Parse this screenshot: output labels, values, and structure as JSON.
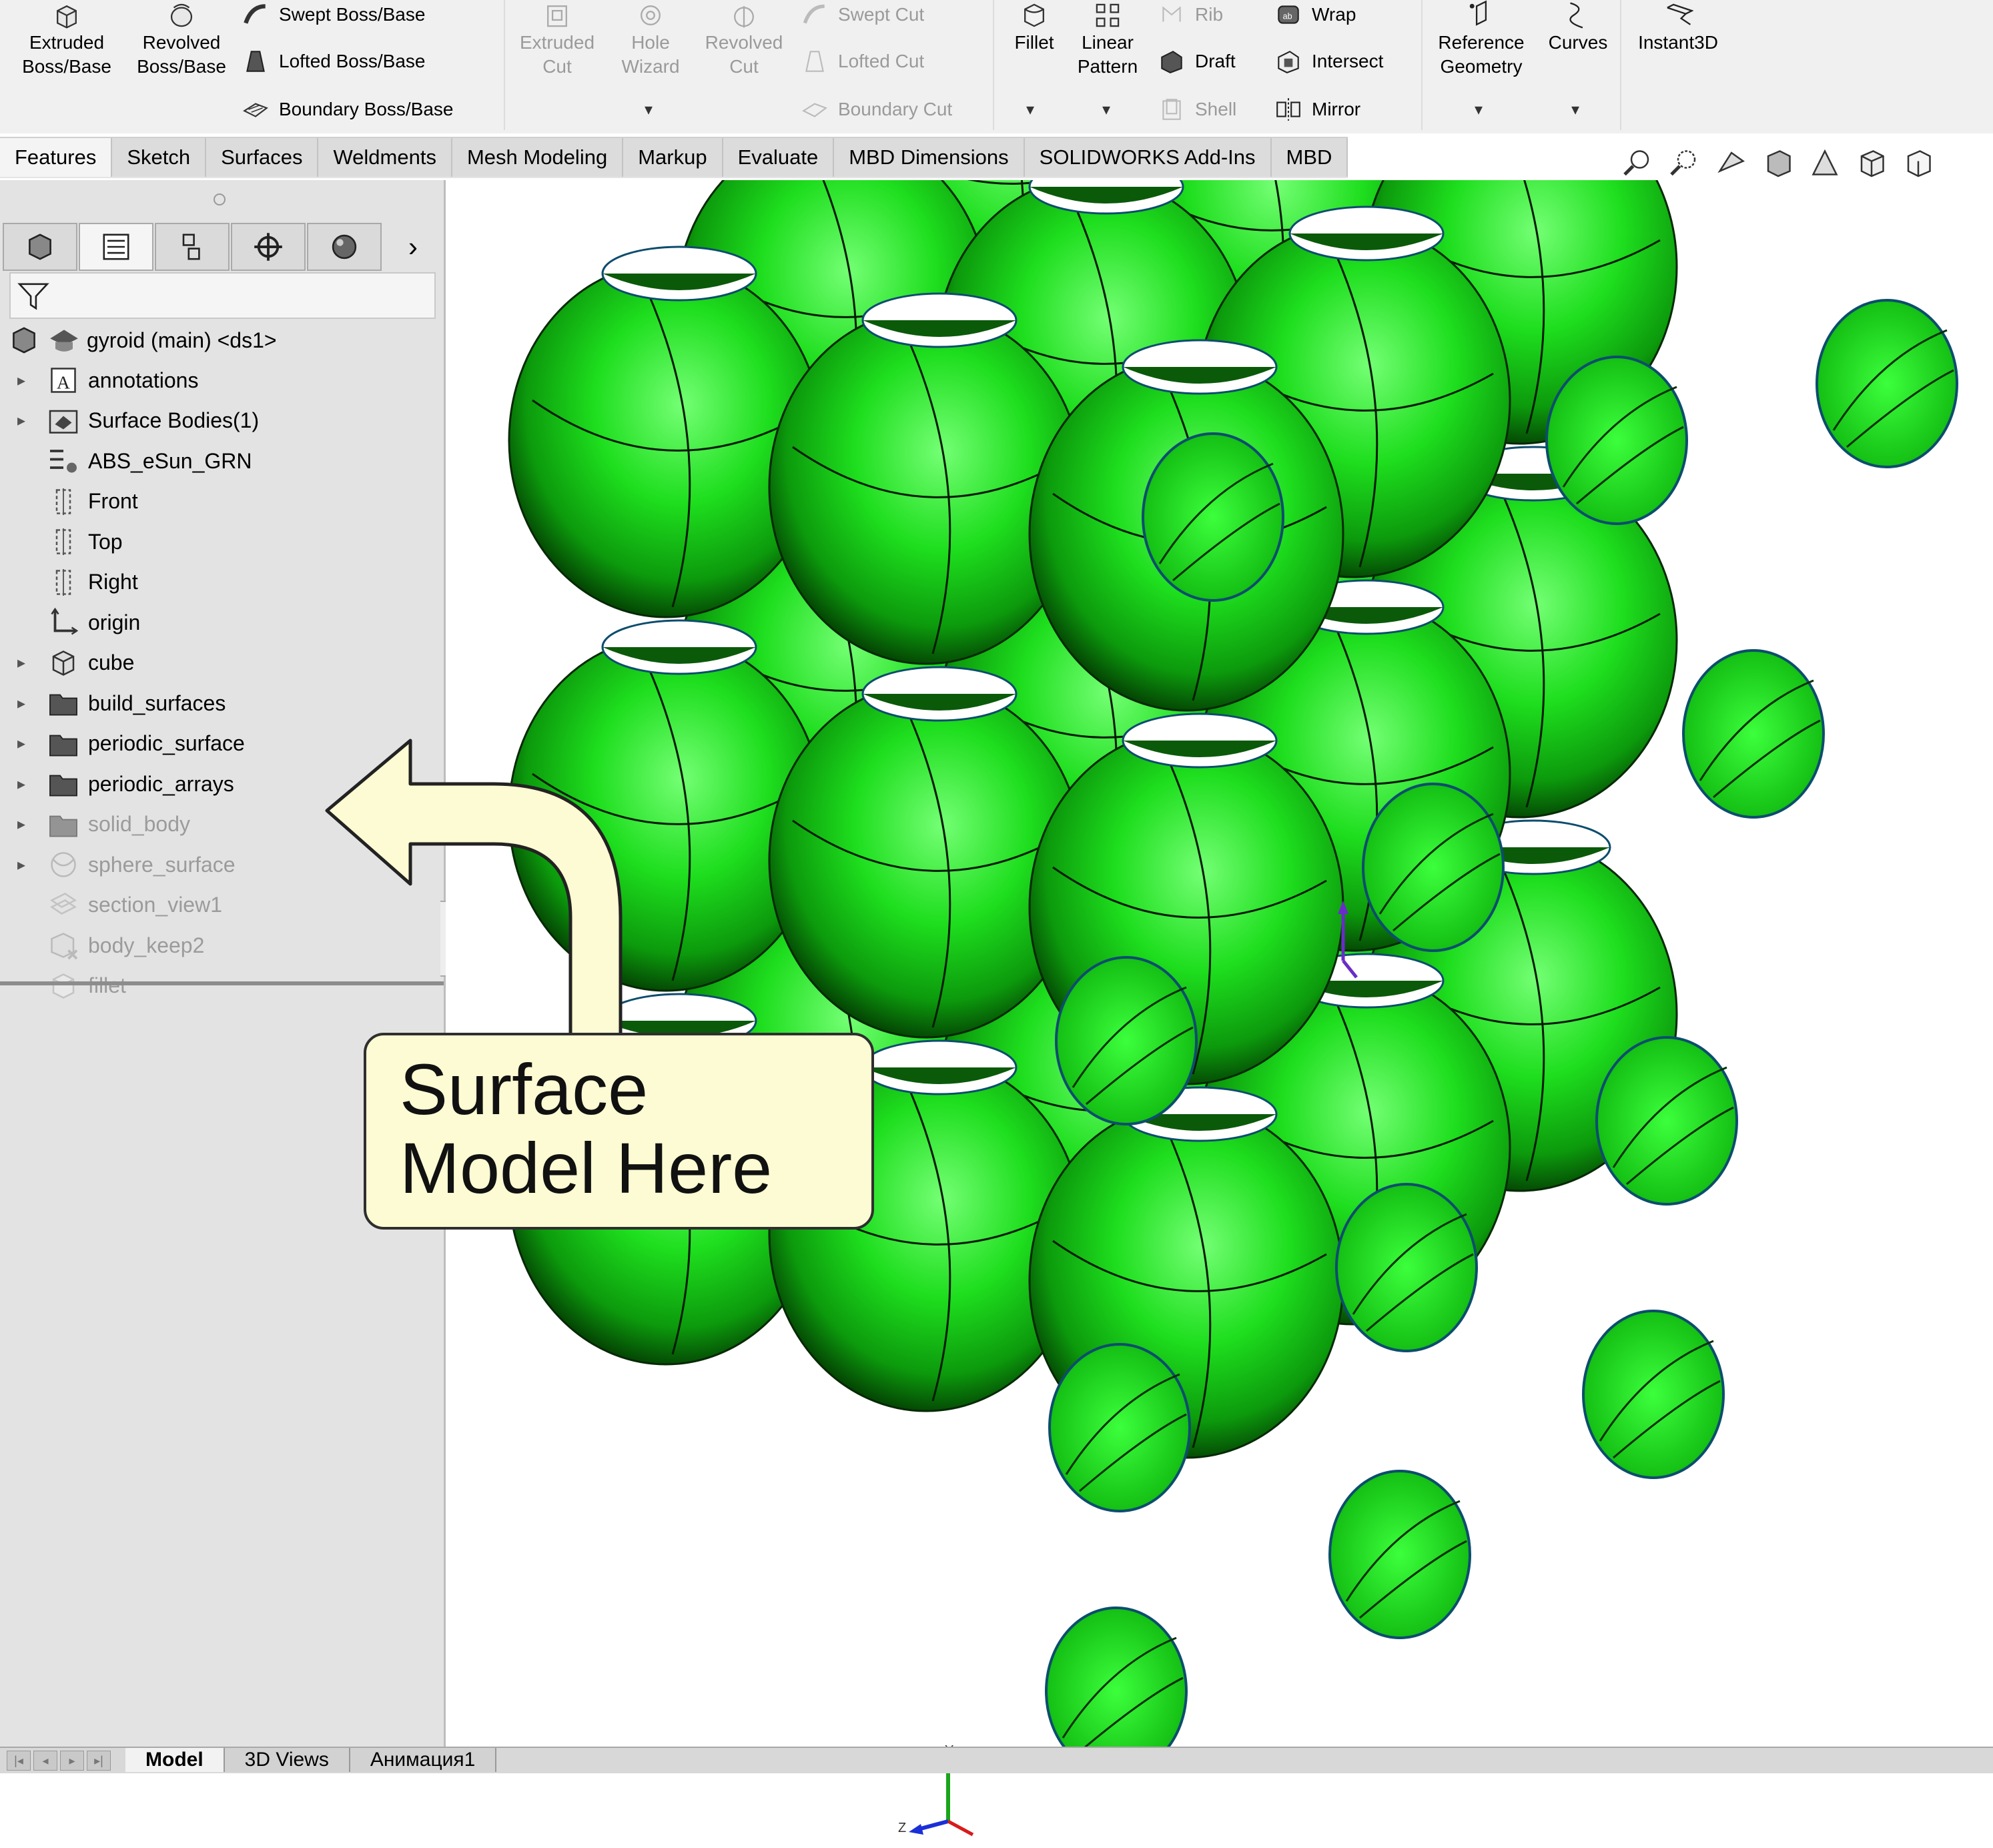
{
  "ribbon": {
    "extruded_boss": "Extruded\nBoss/Base",
    "revolved_boss": "Revolved\nBoss/Base",
    "swept_boss": "Swept Boss/Base",
    "lofted_boss": "Lofted Boss/Base",
    "boundary_boss": "Boundary Boss/Base",
    "extruded_cut": "Extruded\nCut",
    "hole_wizard": "Hole\nWizard",
    "revolved_cut": "Revolved\nCut",
    "swept_cut": "Swept Cut",
    "lofted_cut": "Lofted Cut",
    "boundary_cut": "Boundary Cut",
    "fillet": "Fillet",
    "linear_pattern": "Linear\nPattern",
    "rib": "Rib",
    "draft": "Draft",
    "shell": "Shell",
    "wrap": "Wrap",
    "intersect": "Intersect",
    "mirror": "Mirror",
    "reference_geometry": "Reference\nGeometry",
    "curves": "Curves",
    "instant3d": "Instant3D"
  },
  "command_tabs": [
    "Features",
    "Sketch",
    "Surfaces",
    "Weldments",
    "Mesh Modeling",
    "Markup",
    "Evaluate",
    "MBD Dimensions",
    "SOLIDWORKS Add-Ins",
    "MBD"
  ],
  "view_icons": [
    "zoom-to-fit-icon",
    "zoom-to-area-icon",
    "previous-view-icon",
    "section-view-icon",
    "view-orientation-icon",
    "display-style-icon",
    "hide-show-items-icon"
  ],
  "panel": {
    "tab_icons": [
      "feature-manager-icon",
      "property-manager-icon",
      "configuration-manager-icon",
      "dimxpert-manager-icon",
      "display-manager-icon"
    ],
    "expand_glyph": "›",
    "root_label": "gyroid (main) <ds1>",
    "tree": [
      {
        "label": "annotations",
        "icon": "annotations-icon",
        "expand": true,
        "suppressed": false
      },
      {
        "label": "Surface Bodies(1)",
        "icon": "surface-bodies-icon",
        "expand": true,
        "suppressed": false
      },
      {
        "label": "ABS_eSun_GRN",
        "icon": "material-icon",
        "expand": false,
        "suppressed": false
      },
      {
        "label": "Front",
        "icon": "plane-icon",
        "expand": false,
        "suppressed": false
      },
      {
        "label": "Top",
        "icon": "plane-icon",
        "expand": false,
        "suppressed": false
      },
      {
        "label": "Right",
        "icon": "plane-icon",
        "expand": false,
        "suppressed": false
      },
      {
        "label": "origin",
        "icon": "origin-icon",
        "expand": false,
        "suppressed": false
      },
      {
        "label": "cube",
        "icon": "cube-feature-icon",
        "expand": true,
        "suppressed": false
      },
      {
        "label": "build_surfaces",
        "icon": "folder-icon",
        "expand": true,
        "suppressed": false
      },
      {
        "label": "periodic_surface",
        "icon": "folder-icon",
        "expand": true,
        "suppressed": false
      },
      {
        "label": "periodic_arrays",
        "icon": "folder-icon",
        "expand": true,
        "suppressed": false
      },
      {
        "label": "solid_body",
        "icon": "folder-icon",
        "expand": true,
        "suppressed": true
      },
      {
        "label": "sphere_surface",
        "icon": "revolve-surface-icon",
        "expand": true,
        "suppressed": true
      },
      {
        "label": "section_view1",
        "icon": "section-view-icon",
        "expand": false,
        "suppressed": true
      },
      {
        "label": "body_keep2",
        "icon": "delete-keep-body-icon",
        "expand": false,
        "suppressed": true
      },
      {
        "label": "fillet",
        "icon": "fillet-feature-icon",
        "expand": false,
        "suppressed": true
      }
    ]
  },
  "viewport": {
    "surface_color": "#19d719",
    "axis_labels": {
      "y": "Y",
      "z": "Z"
    }
  },
  "callout": {
    "line1": "Surface",
    "line2": "Model Here"
  },
  "bottom_tabs": [
    "Model",
    "3D Views",
    "Анимация1"
  ]
}
